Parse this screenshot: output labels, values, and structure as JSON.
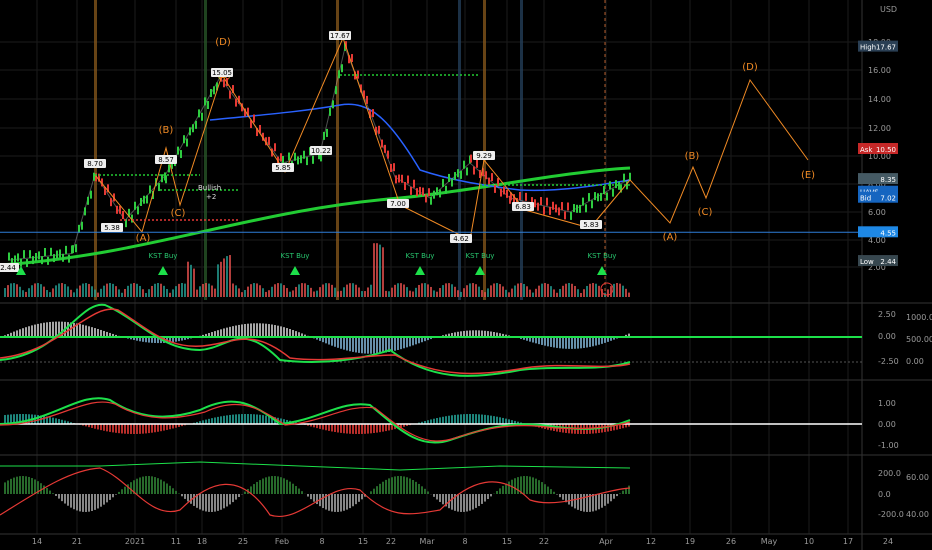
{
  "currency": "USD",
  "colors": {
    "bg": "#000000",
    "up": "#26a69a",
    "down": "#ef5350",
    "green": "#22cc33",
    "orange": "#f08a24",
    "blue": "#2962ff",
    "grid": "#1b1b1b",
    "price_line": "#2e7dd7"
  },
  "price_axis": {
    "ticks": [
      "18.00",
      "16.00",
      "14.00",
      "12.00",
      "10.00",
      "8.00",
      "6.00",
      "4.00",
      "2.00"
    ],
    "badges": [
      {
        "label": "High",
        "value": "17.67",
        "color": "#2a3f54",
        "price": 17.67
      },
      {
        "label": "Ask",
        "value": "10.50",
        "color": "#c62828",
        "price": 10.5
      },
      {
        "label": "",
        "value": "8.35",
        "color": "#455a64",
        "price": 8.35
      },
      {
        "label": "UAVS",
        "value": "",
        "color": "#1565c0",
        "price": 7.45
      },
      {
        "label": "Bid",
        "value": "7.02",
        "color": "#1565c0",
        "price": 7.02
      },
      {
        "label": "",
        "value": "4.55",
        "color": "#1e88e5",
        "price": 4.55
      },
      {
        "label": "Low",
        "value": "2.44",
        "color": "#37474f",
        "price": 2.44
      }
    ]
  },
  "time_axis": [
    "14",
    "21",
    "2021",
    "11",
    "18",
    "25",
    "Feb",
    "8",
    "15",
    "22",
    "Mar",
    "8",
    "15",
    "22",
    "Apr",
    "12",
    "19",
    "26",
    "May",
    "10",
    "17",
    "24"
  ],
  "chart_data": {
    "type": "line",
    "symbol": "UAVS",
    "x": [
      "Dec 14",
      "Dec 21",
      "Jan 4",
      "Jan 11",
      "Jan 18",
      "Jan 25",
      "Feb 1",
      "Feb 8",
      "Feb 15",
      "Feb 22",
      "Mar 1",
      "Mar 8",
      "Mar 15",
      "Mar 22",
      "Apr 1",
      "Apr 5"
    ],
    "series": [
      {
        "values": [
          2.5,
          3.0,
          8.7,
          5.4,
          8.6,
          15.5,
          9.5,
          10.2,
          17.6,
          8.5,
          7.0,
          9.5,
          7.0,
          6.0,
          8.0,
          8.35
        ]
      }
    ],
    "price_labels": [
      "2.44",
      "8.70",
      "5.38",
      "8.57",
      "15.05",
      "5.85",
      "10.22",
      "17.67",
      "7.00",
      "4.62",
      "9.29",
      "6.83",
      "5.83"
    ],
    "wave_labels": [
      "(A)",
      "(B)",
      "(C)",
      "(D)",
      "(E)",
      "(A)",
      "(B)",
      "(C)",
      "(D)",
      "(E)"
    ],
    "signals": [
      "KST Buy",
      "KST Buy",
      "KST Buy",
      "KST Buy",
      "KST Buy"
    ],
    "annotations": [
      "Bullish",
      "+2"
    ],
    "ylim": [
      0,
      19
    ],
    "osc1_axis": [
      "2.50",
      "0.00",
      "-2.50"
    ],
    "osc1_vol_axis": [
      "1000.00",
      "500.00",
      "0.00"
    ],
    "osc2_axis": [
      "1.00",
      "0.00",
      "-1.00"
    ],
    "osc3_axis": [
      "200.0",
      "0.0",
      "-200.0"
    ],
    "osc3_right_axis": [
      "60.00",
      "40.00"
    ]
  }
}
